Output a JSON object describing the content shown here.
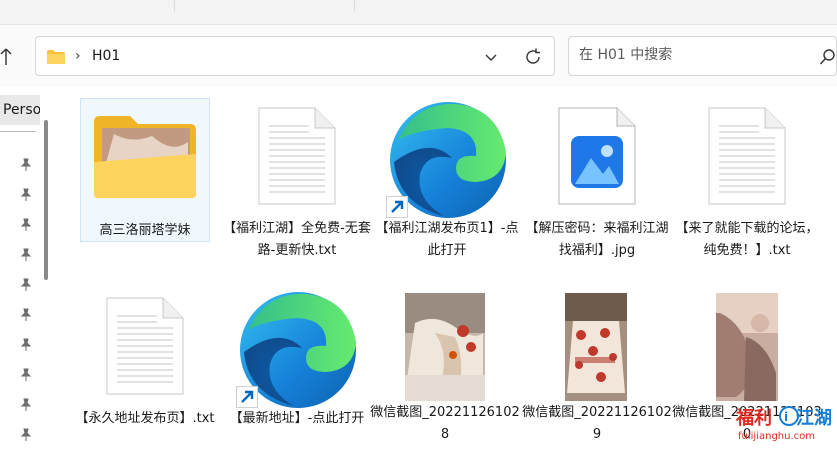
{
  "address_bar": {
    "breadcrumb": "H01",
    "chevron": "›"
  },
  "search": {
    "placeholder": "在 H01 中搜索"
  },
  "nav": {
    "quick_access_label": "Perso"
  },
  "files": [
    {
      "label": "高三洛丽塔学妹",
      "icon": "folder-icon"
    },
    {
      "label": "【福利江湖】全免费-无套路-更新快.txt",
      "icon": "text-file-icon"
    },
    {
      "label": "【福利江湖发布页1】-点此打开",
      "icon": "edge-shortcut-icon"
    },
    {
      "label": "【解压密码：来福利江湖找福利】.jpg",
      "icon": "image-file-icon"
    },
    {
      "label": "【来了就能下载的论坛，纯免费！】.txt",
      "icon": "text-file-icon"
    },
    {
      "label": "【永久地址发布页】.txt",
      "icon": "text-file-icon"
    },
    {
      "label": "【最新地址】-点此打开",
      "icon": "edge-shortcut-icon"
    },
    {
      "label": "微信截图_202211261028",
      "icon": "image-thumbnail"
    },
    {
      "label": "微信截图_202211261029",
      "icon": "image-thumbnail"
    },
    {
      "label": "微信截图_202211261030",
      "icon": "image-thumbnail"
    }
  ],
  "watermark": {
    "text": "福利江湖",
    "url": "fulijianghu.com"
  },
  "colors": {
    "accent": "#0067c0",
    "folder": "#f8c33a",
    "edge_blue": "#1580d8",
    "edge_green": "#3cc48b"
  }
}
